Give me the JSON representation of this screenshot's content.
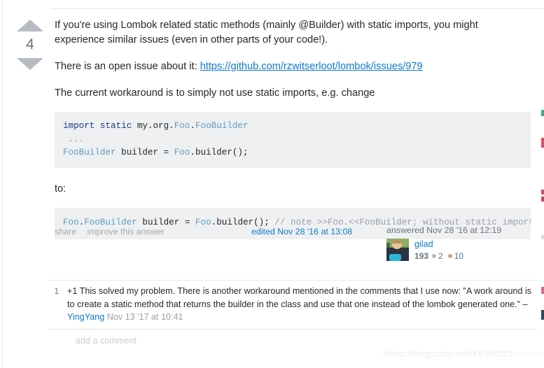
{
  "answer": {
    "vote_score": "4",
    "paragraphs": [
      {
        "before": "If you're using Lombok related static methods (mainly @Builder) with static imports, you might experience similar issues (even in other parts of your code!).",
        "link": "",
        "after": ""
      },
      {
        "before": "There is an open issue about it: ",
        "link": "https://github.com/rzwitserloot/lombok/issues/979",
        "after": ""
      },
      {
        "before": "The current workaround is to simply not use static imports, e.g. change",
        "link": "",
        "after": ""
      }
    ],
    "code_block_1": {
      "line1_keyword": "import static ",
      "line1_plain": "my.org.",
      "line1_type1": "Foo",
      "line1_dot": ".",
      "line1_type2": "FooBuilder",
      "line2": " ...",
      "line3_type1": "FooBuilder",
      "line3_plain1": " builder = ",
      "line3_type2": "Foo",
      "line3_plain2": ".builder();"
    },
    "to_label": "to:",
    "code_block_2": {
      "type1": "Foo",
      "plain1": ".",
      "type2": "FooBuilder",
      "plain2": " builder = ",
      "type3": "Foo",
      "plain3": ".builder(); ",
      "comment": "// note >>Foo.<<FooBuilder; without static import"
    },
    "actions": {
      "share": "share",
      "improve": "improve this answer"
    },
    "edited": "edited Nov 28 '16 at 13:08",
    "answered": "answered Nov 28 '16 at 12:19",
    "user": {
      "name": "gilad",
      "reputation": "193",
      "silver_badges": "2",
      "bronze_badges": "10"
    }
  },
  "comments": [
    {
      "score": "1",
      "text": "+1 This solved my problem. There is another workaround mentioned in the comments that I use now: \"A work around is to create a static method that returns the builder in the class and use that one instead of the lombok generated one.\" – ",
      "user": "YingYang",
      "date": " Nov 13 '17 at 10:41"
    }
  ],
  "add_comment_label": "add a comment",
  "watermark": "https://blog.csdn.net/KEY0323",
  "colors": {
    "link": "#0c7ac9",
    "code_bg": "#eff0f1",
    "keyword": "#17388c",
    "type": "#5b9ec4",
    "comment_gray": "#9aa1a8",
    "text": "#242729",
    "muted": "#6a737c"
  }
}
